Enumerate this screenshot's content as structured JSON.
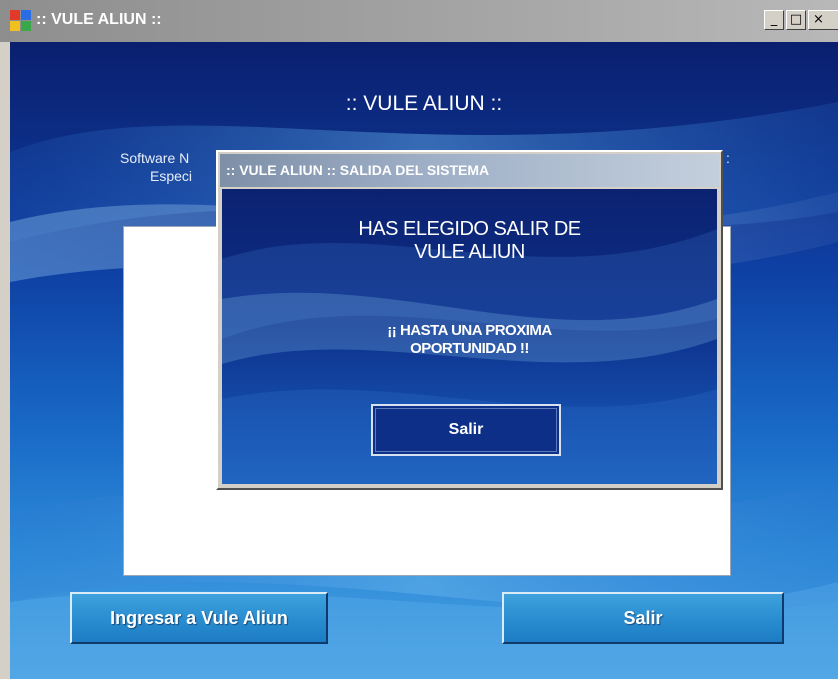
{
  "window": {
    "title": ":: VULE ALIUN ::",
    "minimize_glyph": "_",
    "maximize_glyph": "□",
    "close_glyph": "×"
  },
  "main": {
    "title": ":: VULE ALIUN ::",
    "subtitle_line1": "Software N",
    "subtitle_line2": "Especi",
    "subtitle_right": ":",
    "enter_button": "Ingresar a Vule Aliun",
    "exit_button": "Salir"
  },
  "dialog": {
    "title": ":: VULE ALIUN :: SALIDA DEL SISTEMA",
    "heading_line1": "HAS ELEGIDO SALIR DE",
    "heading_line2": "VULE ALIUN",
    "message_line1": "¡¡ HASTA UNA PROXIMA",
    "message_line2": "OPORTUNIDAD !!",
    "exit_button": "Salir"
  },
  "colors": {
    "background_dark": "#0a1f6e",
    "background_light": "#4ca2e3",
    "button_blue": "#2a8ed1",
    "dialog_button": "#0d2f88"
  },
  "icons": {
    "app_icon": "windows-app-icon"
  }
}
